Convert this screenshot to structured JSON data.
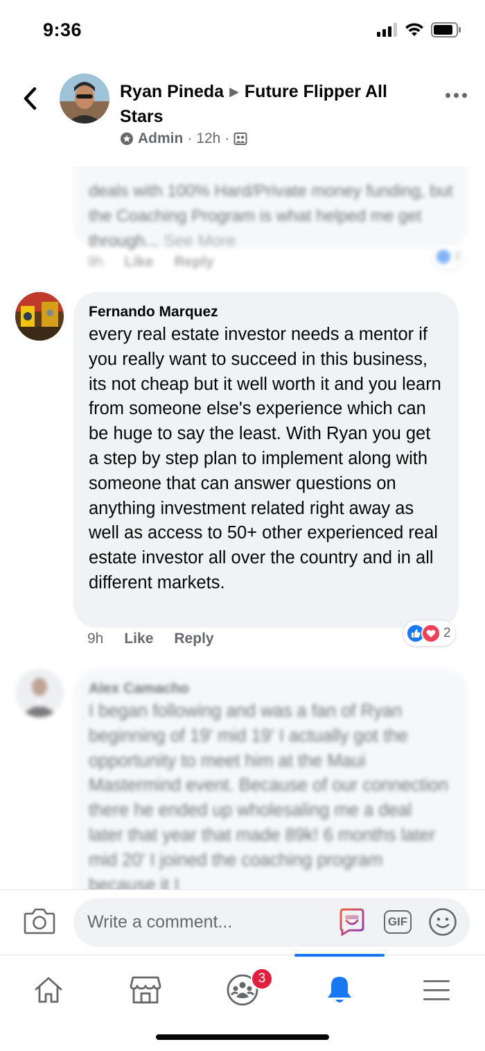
{
  "status_bar": {
    "time": "9:36",
    "icons": [
      "signal-icon",
      "wifi-icon",
      "battery-icon"
    ]
  },
  "header": {
    "author": "Ryan Pineda",
    "group": "Future Flipper All Stars",
    "role": "Admin",
    "time": "12h",
    "privacy_icon": "group-members-icon"
  },
  "comments": [
    {
      "author": "",
      "text": "deals with 100% Hard/Private money funding, but the Coaching Program is what helped me get through...",
      "see_more": "See More",
      "time": "9h",
      "like": "Like",
      "reply": "Reply",
      "reaction_count": "2",
      "blurred": true
    },
    {
      "author": "Fernando Marquez",
      "text": "every real estate investor needs a mentor if you really want to succeed in this business, its not cheap but it well worth it and you learn from someone else's experience which can be huge to say the least. With Ryan you get a step by step plan to implement along with someone that can answer questions on anything investment related right away as well as access to 50+ other experienced real estate investor all over the country and in all different markets.",
      "time": "9h",
      "like": "Like",
      "reply": "Reply",
      "reaction_count": "2",
      "blurred": false
    },
    {
      "author": "Alex Camacho",
      "text": "I began following and was a fan of Ryan beginning of 19' mid 19' I actually got the opportunity to meet him at the Maui Mastermind event. Because of our connection there he ended up wholesaling me a deal later that year that made 89k! 6 months later mid 20' I joined the coaching program because it I",
      "blurred": true
    }
  ],
  "composer": {
    "placeholder": "Write a comment...",
    "gif_label": "GIF"
  },
  "tabbar": {
    "items": [
      "home-icon",
      "marketplace-icon",
      "groups-icon",
      "notifications-icon",
      "menu-icon"
    ],
    "groups_badge": "3",
    "active": "notifications-icon"
  },
  "colors": {
    "accent": "#1877f2",
    "bubble": "#f0f2f5",
    "secondary_text": "#65676b",
    "badge": "#e41e3f",
    "love": "#f33e58"
  }
}
